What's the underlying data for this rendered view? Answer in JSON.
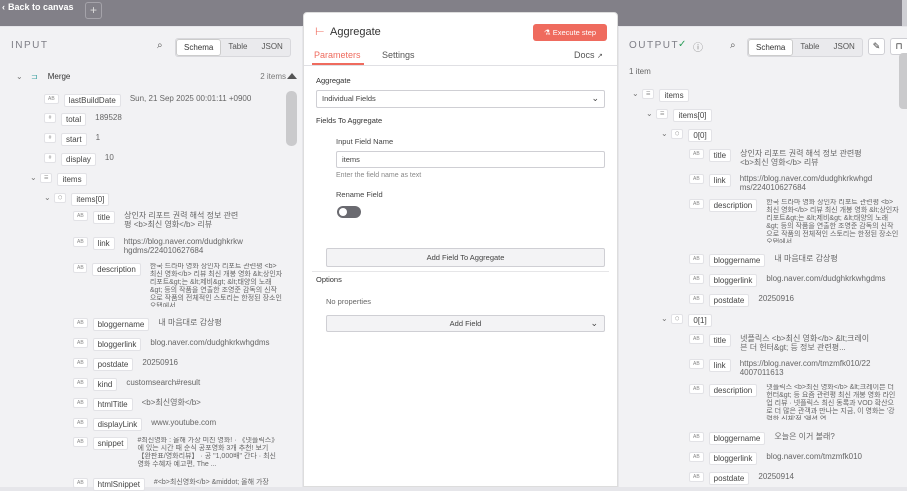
{
  "topbar": {
    "back_label": "Back to canvas",
    "add_label": "+"
  },
  "input": {
    "title": "INPUT",
    "views": [
      "Schema",
      "Table",
      "JSON"
    ],
    "node_name": "Merge",
    "item_count": "2 items",
    "fields": [
      {
        "tag": "AB",
        "key": "lastBuildDate",
        "value": "Sun, 21 Sep 2025 00:01:11 +0900"
      },
      {
        "tag": "#",
        "key": "total",
        "value": "189528"
      },
      {
        "tag": "#",
        "key": "start",
        "value": "1"
      },
      {
        "tag": "#",
        "key": "display",
        "value": "10"
      }
    ],
    "items_key": "items",
    "item0_key": "items[0]",
    "item_fields": [
      {
        "tag": "AB",
        "key": "title",
        "value": "상인자 리포트 권력 해석 정보 관련평 <b>최신 영화</b> 리뷰"
      },
      {
        "tag": "AB",
        "key": "link",
        "value": "https://blog.naver.com/dudghkrkwhgdms/224010627684"
      },
      {
        "tag": "AB",
        "key": "description",
        "value": "한국 드라마 영화 상인자 리포트 관련평 <b>최신 영화</b> 리뷰 최신 개봉 영화 &lt;상인자 리포트&gt;는 &lt;제비&gt; &lt;태양의 노래&gt; 등의 작품을 연출한 조영준 감독의 신작으로 작품의 전체적인 스토리는 한정된 장소인 오탭에서..."
      },
      {
        "tag": "AB",
        "key": "bloggername",
        "value": "내 마음대로 감상평"
      },
      {
        "tag": "AB",
        "key": "bloggerlink",
        "value": "blog.naver.com/dudghkrkwhgdms"
      },
      {
        "tag": "AB",
        "key": "postdate",
        "value": "20250916"
      },
      {
        "tag": "AB",
        "key": "kind",
        "value": "customsearch#result"
      },
      {
        "tag": "AB",
        "key": "htmlTitle",
        "value": "<b>최신영화</b>"
      },
      {
        "tag": "AB",
        "key": "displayLink",
        "value": "www.youtube.com"
      },
      {
        "tag": "AB",
        "key": "snippet",
        "value": "#최신영화 : 올해 가장 미친 영화! · 《넷플릭스》에 있는 시간 때 순식 공포영화 3개 추천! 보기 【완판표/영화리뷰】 · 공 \"1,000배\" 간다 · 최신영화 수혜자 예고편, The ..."
      },
      {
        "tag": "AB",
        "key": "htmlSnippet",
        "value": "#<b>최신영화</b> &middot; 올해 가장"
      }
    ]
  },
  "node": {
    "title": "Aggregate",
    "execute_label": "Execute step",
    "tabs": [
      "Parameters",
      "Settings"
    ],
    "docs_label": "Docs",
    "aggregate_label": "Aggregate",
    "aggregate_value": "Individual Fields",
    "fields_to_aggregate_label": "Fields To Aggregate",
    "input_field_name_label": "Input Field Name",
    "input_field_name_value": "items",
    "input_field_hint": "Enter the field name as text",
    "rename_field_label": "Rename Field",
    "add_field_to_aggregate_label": "Add Field To Aggregate",
    "options_label": "Options",
    "no_properties": "No properties",
    "add_field_label": "Add Field"
  },
  "output": {
    "title": "OUTPUT",
    "views": [
      "Schema",
      "Table",
      "JSON"
    ],
    "item_count": "1 item",
    "items_key": "items",
    "items0_key": "items[0]",
    "obj0_key": "0[0]",
    "obj0_fields": [
      {
        "tag": "AB",
        "key": "title",
        "value": "상인자 리포트 권력 해석 정보 관련평 <b>최신 영화</b> 리뷰"
      },
      {
        "tag": "AB",
        "key": "link",
        "value": "https://blog.naver.com/dudghkrkwhgdms/224010627684"
      },
      {
        "tag": "AB",
        "key": "description",
        "value": "한국 드라마 영화 상인자 리포트 관련평 <b>최신 영화</b> 리뷰 최신 개봉 영화 &lt;상인자 리포트&gt;는 &lt;제비&gt; &lt;태양의 노래&gt; 등의 작품을 연출한 조영준 감독의 신작으로 작품의 전체적인 스토리는 한정된 장소인 오탭에서..."
      },
      {
        "tag": "AB",
        "key": "bloggername",
        "value": "내 마음대로 감상평"
      },
      {
        "tag": "AB",
        "key": "bloggerlink",
        "value": "blog.naver.com/dudghkrkwhgdms"
      },
      {
        "tag": "AB",
        "key": "postdate",
        "value": "20250916"
      }
    ],
    "obj1_key": "0[1]",
    "obj1_fields": [
      {
        "tag": "AB",
        "key": "title",
        "value": "넷플릭스 <b>최신 영화</b> &lt;크레이븐 더 헌터&gt; 등 정보 관련평..."
      },
      {
        "tag": "AB",
        "key": "link",
        "value": "https://blog.naver.com/tmzmfk010/224007011613"
      },
      {
        "tag": "AB",
        "key": "description",
        "value": "넷플릭스 <b>최신 영화</b> &lt;크레이븐 더 헌터&gt; 등 요즘 관련평 최신 개봉 영화 라인업 리뷰 · 넷플릭스 최신 동록과 VOD 확산으로 더 많은 관객과 만나는 지금, 이 영화는 '강렬한 신체'적 '액션 연..."
      },
      {
        "tag": "AB",
        "key": "bloggername",
        "value": "오늘은 이거 볼래?"
      },
      {
        "tag": "AB",
        "key": "bloggerlink",
        "value": "blog.naver.com/tmzmfk010"
      },
      {
        "tag": "AB",
        "key": "postdate",
        "value": "20250914"
      }
    ]
  },
  "colors": {
    "accent": "#ef6b5e",
    "success": "#2e9e5b"
  }
}
